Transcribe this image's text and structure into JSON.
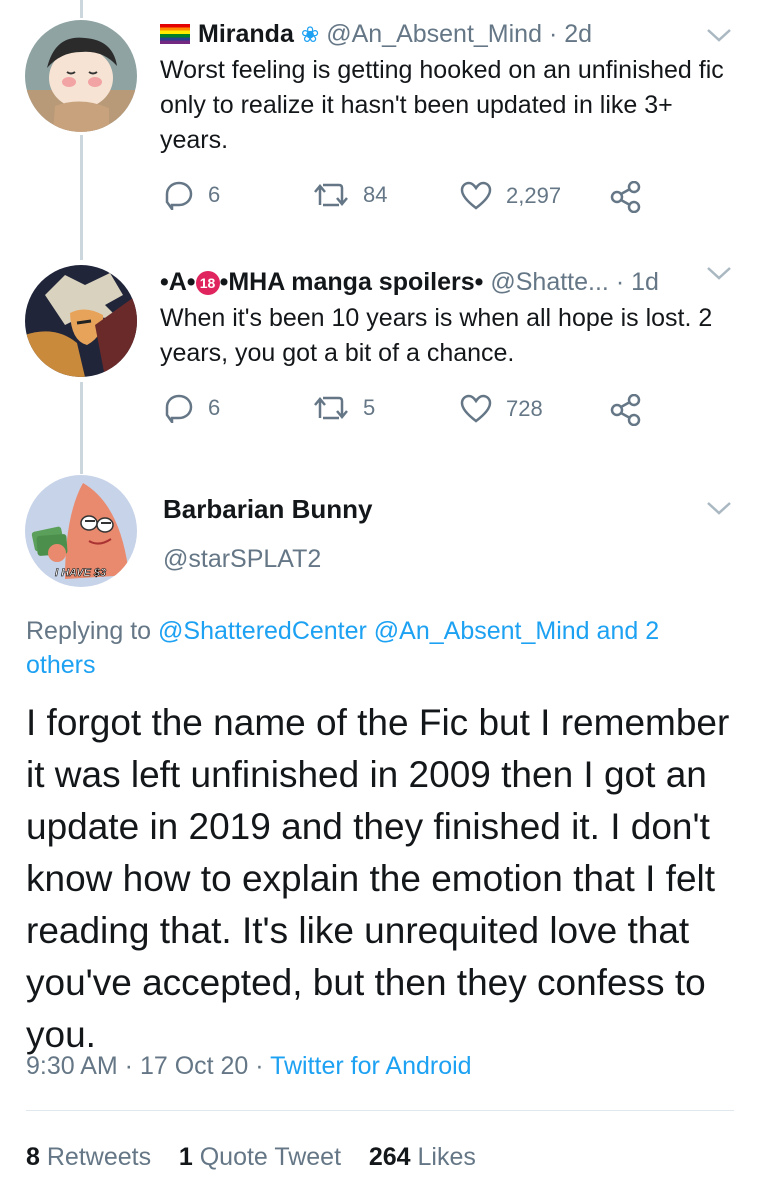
{
  "tweet1": {
    "name": "Miranda",
    "handle": "@An_Absent_Mind",
    "time": "· 2d",
    "text": "Worst feeling is getting hooked on an unfinished fic only to realize it hasn't been updated in like 3+ years.",
    "replies": "6",
    "retweets": "84",
    "likes": "2,297"
  },
  "tweet2": {
    "name_prefix": "•A•",
    "badge": "18",
    "name_suffix": "•MHA manga spoilers•",
    "handle": "@Shatte...",
    "time": "· 1d",
    "text": "When it's been 10 years is when all hope is lost. 2 years, you got a bit of a chance.",
    "replies": "6",
    "retweets": "5",
    "likes": "728"
  },
  "main": {
    "name": "Barbarian Bunny",
    "handle": "@starSPLAT2",
    "avatar_caption": "I HAVE $3",
    "replying_prefix": "Replying to",
    "replying_users": "@ShatteredCenter @An_Absent_Mind",
    "replying_and": "and 2 others",
    "text": "I forgot the name of the Fic but I remember it was left unfinished in 2009 then I got an update in 2019 and they finished it. I don't know how to explain the emotion that I felt reading that. It's like unrequited love that you've accepted, but then they confess to you.",
    "timestamp": "9:30 AM · 17 Oct 20 · ",
    "source": "Twitter for Android",
    "retweet_count": "8",
    "retweet_label": "Retweets",
    "quote_count": "1",
    "quote_label": "Quote Tweet",
    "like_count": "264",
    "like_label": "Likes"
  },
  "colors": {
    "accent": "#1da1f2",
    "secondary_text": "#657786",
    "primary_text": "#14171a",
    "divider": "#e1e8ed"
  }
}
